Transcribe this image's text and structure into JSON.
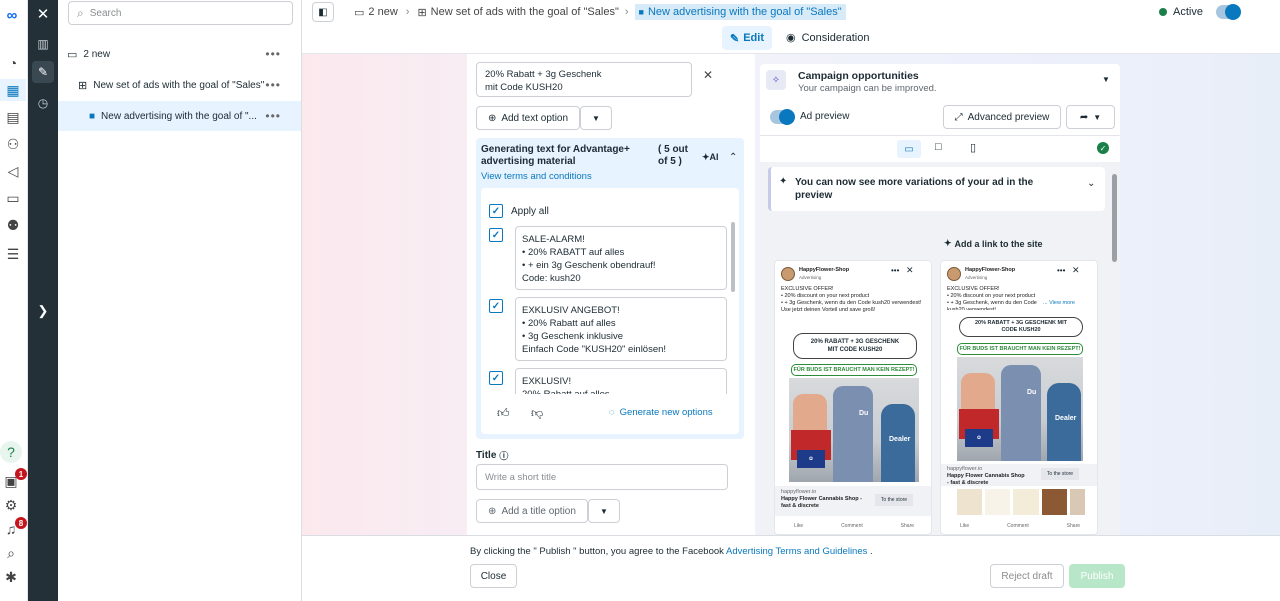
{
  "search": {
    "placeholder": "Search"
  },
  "tree": {
    "campaign": "2 new",
    "adset": "New set of ads with the goal of \"Sales\"",
    "ad": "New advertising with the goal of \"..."
  },
  "badges": {
    "notifications_a": "1",
    "notifications_b": "8"
  },
  "breadcrumb": {
    "campaign": "2 new",
    "adset": "New set of ads with the goal of \"Sales\"",
    "ad": "New advertising with the goal of \"Sales\""
  },
  "status": {
    "label": "Active"
  },
  "modes": {
    "edit": "Edit",
    "consideration": "Consideration"
  },
  "form": {
    "primary_text_value": "20% Rabatt + 3g Geschenk\nmit Code KUSH20",
    "add_text_option": "Add text option",
    "ai_title": "Generating text for Advantage+ advertising material",
    "ai_count": "( 5 out of 5 )",
    "ai_label": "AI",
    "terms_link": "View terms and conditions",
    "apply_all": "Apply all",
    "options": [
      {
        "text": "SALE-ALARM!\n• 20% RABATT auf alles\n• + ein 3g Geschenk obendrauf!\nCode: kush20"
      },
      {
        "text": "EXKLUSIV ANGEBOT!\n• 20% Rabatt auf alles\n• 3g Geschenk inklusive\nEinfach Code \"KUSH20\" einlösen!"
      },
      {
        "text": "EXKLUSIV!\n20% Rabatt auf alles"
      }
    ],
    "generate_new": "Generate new options",
    "title_label": "Title",
    "title_placeholder": "Write a short title",
    "add_title_option": "Add a title option"
  },
  "preview": {
    "opportunities_title": "Campaign opportunities",
    "opportunities_sub": "Your campaign can be improved.",
    "ad_preview_label": "Ad preview",
    "advanced_preview": "Advanced preview",
    "variations_notice": "You can now see more variations of your ad in the preview",
    "add_link": "Add a link to the site"
  },
  "adcard": {
    "page_name": "HappyFlower-Shop",
    "sponsored": "Advertising",
    "body_1": "EXCLUSIVE OFFER!\n• 20% discount on your next product\n• + 3g Geschenk, wenn du den Code kush20 verwendest!\nUse jetzt deinen Vorteil und save groß!",
    "body_2": "EXCLUSIVE OFFER!\n• 20% discount on your next product\n• + 3g Geschenk, wenn du den Code kush20 verwendest!",
    "see_more": "... View more",
    "bubble_1": "20% RABATT + 3G GESCHENK MIT CODE KUSH20",
    "bubble_2": "FÜR BUDS IST BRAUCHT MAN KEIN REZEPT!",
    "label_du": "Du",
    "label_dealer": "Dealer",
    "domain": "happyflower.io",
    "headline": "Happy Flower Cannabis Shop - fast & discrete",
    "cta": "To the store",
    "like": "Like",
    "comment": "Comment",
    "share": "Share"
  },
  "footer": {
    "notice_prefix": "By clicking the \" Publish \" button, you agree to the Facebook",
    "notice_link": "Advertising Terms and Guidelines",
    "notice_suffix": ".",
    "close": "Close",
    "reject": "Reject draft",
    "publish": "Publish"
  },
  "colors": {
    "accent": "#0a78be",
    "publish_disabled": "#b8e6c8",
    "highlight_bg": "#e7f3ff"
  }
}
